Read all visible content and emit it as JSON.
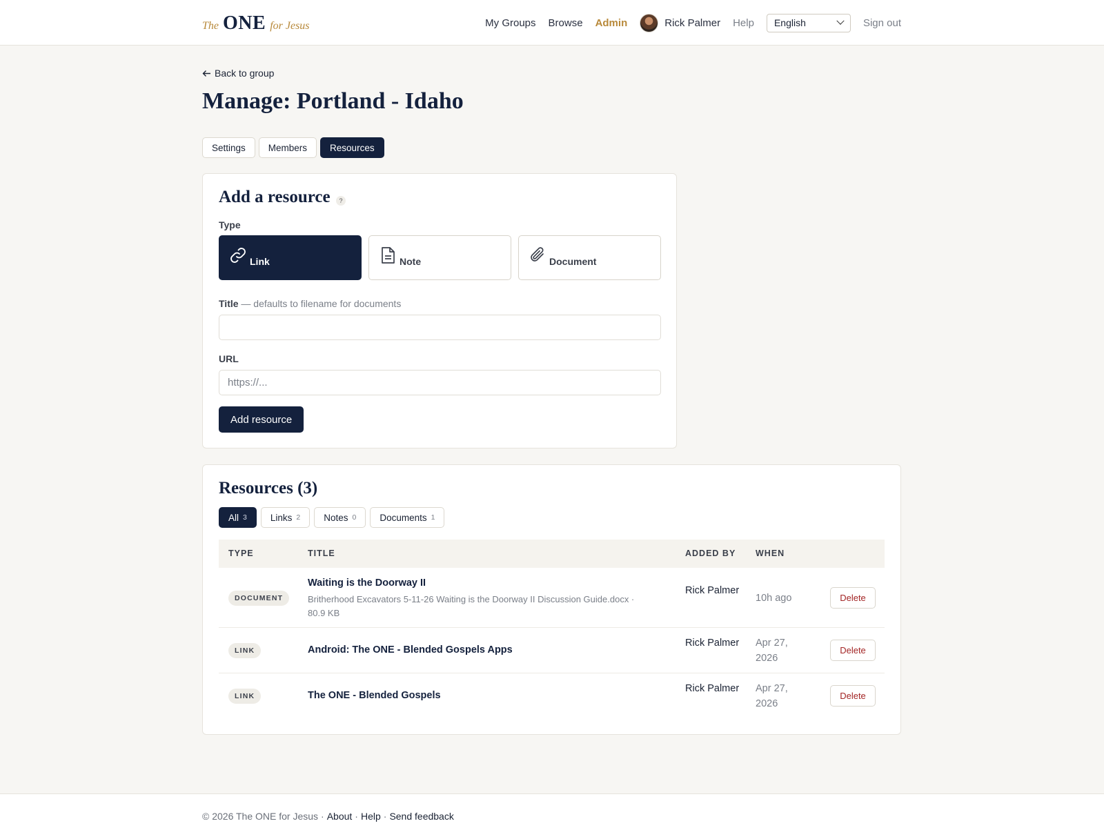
{
  "brand": {
    "prefix": "The",
    "name": "ONE",
    "suffix": "for Jesus"
  },
  "nav": {
    "my_groups": "My Groups",
    "browse": "Browse",
    "admin": "Admin",
    "user_name": "Rick Palmer",
    "help": "Help",
    "language": "English",
    "sign_out": "Sign out"
  },
  "back_link": "Back to group",
  "page_title": "Manage: Portland - Idaho",
  "tabs": [
    "Settings",
    "Members",
    "Resources"
  ],
  "active_tab": "Resources",
  "add_form": {
    "heading": "Add a resource",
    "help_icon": "?",
    "type_label": "Type",
    "types": [
      {
        "label": "Link",
        "icon": "link-icon",
        "active": true
      },
      {
        "label": "Note",
        "icon": "note-icon",
        "active": false
      },
      {
        "label": "Document",
        "icon": "paperclip-icon",
        "active": false
      }
    ],
    "title_label": "Title",
    "title_hint": "— defaults to filename for documents",
    "title_value": "",
    "url_label": "URL",
    "url_placeholder": "https://...",
    "submit": "Add resource"
  },
  "resources": {
    "heading": "Resources (3)",
    "filters": [
      {
        "label": "All",
        "count": "3",
        "active": true
      },
      {
        "label": "Links",
        "count": "2",
        "active": false
      },
      {
        "label": "Notes",
        "count": "0",
        "active": false
      },
      {
        "label": "Documents",
        "count": "1",
        "active": false
      }
    ],
    "columns": [
      "TYPE",
      "TITLE",
      "ADDED BY",
      "WHEN"
    ],
    "rows": [
      {
        "type": "DOCUMENT",
        "title": "Waiting is the Doorway II",
        "subtitle": "Britherhood Excavators 5-11-26 Waiting is the Doorway II Discussion Guide.docx · 80.9 KB",
        "added_by": "Rick Palmer",
        "when": "10h ago",
        "action": "Delete"
      },
      {
        "type": "LINK",
        "title": "Android: The ONE - Blended Gospels Apps",
        "subtitle": "",
        "added_by": "Rick Palmer",
        "when": "Apr 27, 2026",
        "action": "Delete"
      },
      {
        "type": "LINK",
        "title": "The ONE - Blended Gospels",
        "subtitle": "",
        "added_by": "Rick Palmer",
        "when": "Apr 27, 2026",
        "action": "Delete"
      }
    ]
  },
  "footer": {
    "copyright": "© 2026 The ONE for Jesus",
    "sep": "·",
    "about": "About",
    "help": "Help",
    "feedback": "Send feedback"
  },
  "colors": {
    "navy": "#14213d",
    "gold": "#b8893a",
    "danger": "#a32525"
  }
}
